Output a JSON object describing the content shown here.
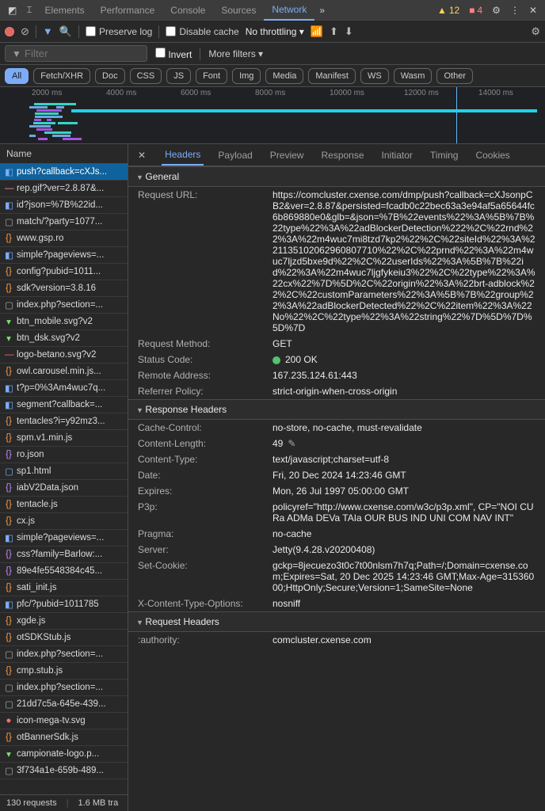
{
  "topTabs": {
    "items": [
      "Elements",
      "Performance",
      "Console",
      "Sources",
      "Network"
    ],
    "active": "Network",
    "warnings": "12",
    "errors": "4"
  },
  "toolbar": {
    "preserveLog": "Preserve log",
    "disableCache": "Disable cache",
    "throttling": "No throttling"
  },
  "filter": {
    "placeholder": "Filter",
    "invert": "Invert",
    "moreFilters": "More filters"
  },
  "types": [
    "All",
    "Fetch/XHR",
    "Doc",
    "CSS",
    "JS",
    "Font",
    "Img",
    "Media",
    "Manifest",
    "WS",
    "Wasm",
    "Other"
  ],
  "typeActive": "All",
  "timeline": {
    "ticks": [
      "2000 ms",
      "4000 ms",
      "6000 ms",
      "8000 ms",
      "10000 ms",
      "12000 ms",
      "14000 ms"
    ]
  },
  "nameHeader": "Name",
  "requests": [
    {
      "name": "push?callback=cXJs...",
      "icon": "◧",
      "color": "c-blue",
      "sel": true
    },
    {
      "name": "rep.gif?ver=2.8.87&...",
      "icon": "—",
      "color": "c-pink"
    },
    {
      "name": "id?json=%7B%22id...",
      "icon": "◧",
      "color": "c-blue"
    },
    {
      "name": "match/?party=1077...",
      "icon": "▢",
      "color": "c-gray"
    },
    {
      "name": "www.gsp.ro",
      "icon": "{}",
      "color": "c-orange"
    },
    {
      "name": "simple?pageviews=...",
      "icon": "◧",
      "color": "c-blue"
    },
    {
      "name": "config?pubid=1011...",
      "icon": "{}",
      "color": "c-orange"
    },
    {
      "name": "sdk?version=3.8.16",
      "icon": "{}",
      "color": "c-orange"
    },
    {
      "name": "index.php?section=...",
      "icon": "▢",
      "color": "c-gray"
    },
    {
      "name": "btn_mobile.svg?v2",
      "icon": "▾",
      "color": "c-green"
    },
    {
      "name": "btn_dsk.svg?v2",
      "icon": "▾",
      "color": "c-green"
    },
    {
      "name": "logo-betano.svg?v2",
      "icon": "—",
      "color": "c-red"
    },
    {
      "name": "owl.carousel.min.js...",
      "icon": "{}",
      "color": "c-orange"
    },
    {
      "name": "t?p=0%3Am4wuc7q...",
      "icon": "◧",
      "color": "c-blue"
    },
    {
      "name": "segment?callback=...",
      "icon": "◧",
      "color": "c-blue"
    },
    {
      "name": "tentacles?i=y92mz3...",
      "icon": "{}",
      "color": "c-orange"
    },
    {
      "name": "spm.v1.min.js",
      "icon": "{}",
      "color": "c-orange"
    },
    {
      "name": "ro.json",
      "icon": "{}",
      "color": "c-purple"
    },
    {
      "name": "sp1.html",
      "icon": "▢",
      "color": "c-blue"
    },
    {
      "name": "iabV2Data.json",
      "icon": "{}",
      "color": "c-purple"
    },
    {
      "name": "tentacle.js",
      "icon": "{}",
      "color": "c-orange"
    },
    {
      "name": "cx.js",
      "icon": "{}",
      "color": "c-orange"
    },
    {
      "name": "simple?pageviews=...",
      "icon": "◧",
      "color": "c-blue"
    },
    {
      "name": "css?family=Barlow:...",
      "icon": "{}",
      "color": "c-purple"
    },
    {
      "name": "89e4fe5548384c45...",
      "icon": "{}",
      "color": "c-purple"
    },
    {
      "name": "sati_init.js",
      "icon": "{}",
      "color": "c-orange"
    },
    {
      "name": "pfc/?pubid=1011785",
      "icon": "◧",
      "color": "c-blue"
    },
    {
      "name": "xgde.js",
      "icon": "{}",
      "color": "c-orange"
    },
    {
      "name": "otSDKStub.js",
      "icon": "{}",
      "color": "c-orange"
    },
    {
      "name": "index.php?section=...",
      "icon": "▢",
      "color": "c-gray"
    },
    {
      "name": "cmp.stub.js",
      "icon": "{}",
      "color": "c-orange"
    },
    {
      "name": "index.php?section=...",
      "icon": "▢",
      "color": "c-gray"
    },
    {
      "name": "21dd7c5a-645e-439...",
      "icon": "▢",
      "color": "c-gray"
    },
    {
      "name": "icon-mega-tv.svg",
      "icon": "●",
      "color": "c-red"
    },
    {
      "name": "otBannerSdk.js",
      "icon": "{}",
      "color": "c-orange"
    },
    {
      "name": "campionate-logo.p...",
      "icon": "▾",
      "color": "c-green"
    },
    {
      "name": "3f734a1e-659b-489...",
      "icon": "▢",
      "color": "c-gray"
    }
  ],
  "statusBar": {
    "requests": "130 requests",
    "transfer": "1.6 MB tra"
  },
  "detailTabs": [
    "Headers",
    "Payload",
    "Preview",
    "Response",
    "Initiator",
    "Timing",
    "Cookies"
  ],
  "detailActive": "Headers",
  "sections": {
    "general": {
      "title": "General",
      "items": [
        {
          "k": "Request URL:",
          "v": "https://comcluster.cxense.com/dmp/push?callback=cXJsonpCB2&ver=2.8.87&persisted=fcadb0c22bec63a3e94af5a65644fc6b869880e0&glb=&json=%7B%22events%22%3A%5B%7B%22type%22%3A%22adBlockerDetection%222%2C%22rnd%22%3A%22m4wuc7mi8tzd7kp2%22%2C%22siteId%22%3A%221135102062960807710%22%2C%22prnd%22%3A%22m4wuc7ljzd5bxe9d%22%2C%22userIds%22%3A%5B%7B%22id%22%3A%22m4wuc7ljgfykeiu3%22%2C%22type%22%3A%22cx%22%7D%5D%2C%22origin%22%3A%22brt-adblock%22%2C%22customParameters%22%3A%5B%7B%22group%22%3A%22adBlockerDetected%22%2C%22item%22%3A%22No%22%2C%22type%22%3A%22string%22%7D%5D%7D%5D%7D"
        },
        {
          "k": "Request Method:",
          "v": "GET"
        },
        {
          "k": "Status Code:",
          "v": "200 OK",
          "status": true
        },
        {
          "k": "Remote Address:",
          "v": "167.235.124.61:443"
        },
        {
          "k": "Referrer Policy:",
          "v": "strict-origin-when-cross-origin"
        }
      ]
    },
    "response": {
      "title": "Response Headers",
      "items": [
        {
          "k": "Cache-Control:",
          "v": "no-store, no-cache, must-revalidate"
        },
        {
          "k": "Content-Length:",
          "v": "49",
          "edit": true
        },
        {
          "k": "Content-Type:",
          "v": "text/javascript;charset=utf-8"
        },
        {
          "k": "Date:",
          "v": "Fri, 20 Dec 2024 14:23:46 GMT"
        },
        {
          "k": "Expires:",
          "v": "Mon, 26 Jul 1997 05:00:00 GMT"
        },
        {
          "k": "P3p:",
          "v": "policyref=\"http://www.cxense.com/w3c/p3p.xml\", CP=\"NOI CURa ADMa DEVa TAIa OUR BUS IND UNI COM NAV INT\""
        },
        {
          "k": "Pragma:",
          "v": "no-cache"
        },
        {
          "k": "Server:",
          "v": "Jetty(9.4.28.v20200408)"
        },
        {
          "k": "Set-Cookie:",
          "v": "gckp=8jecuezo3t0c7t00nlsm7h7q;Path=/;Domain=cxense.com;Expires=Sat, 20 Dec 2025 14:23:46 GMT;Max-Age=31536000;HttpOnly;Secure;Version=1;SameSite=None"
        },
        {
          "k": "X-Content-Type-Options:",
          "v": "nosniff"
        }
      ]
    },
    "request": {
      "title": "Request Headers",
      "items": [
        {
          "k": ":authority:",
          "v": "comcluster.cxense.com"
        }
      ]
    }
  }
}
